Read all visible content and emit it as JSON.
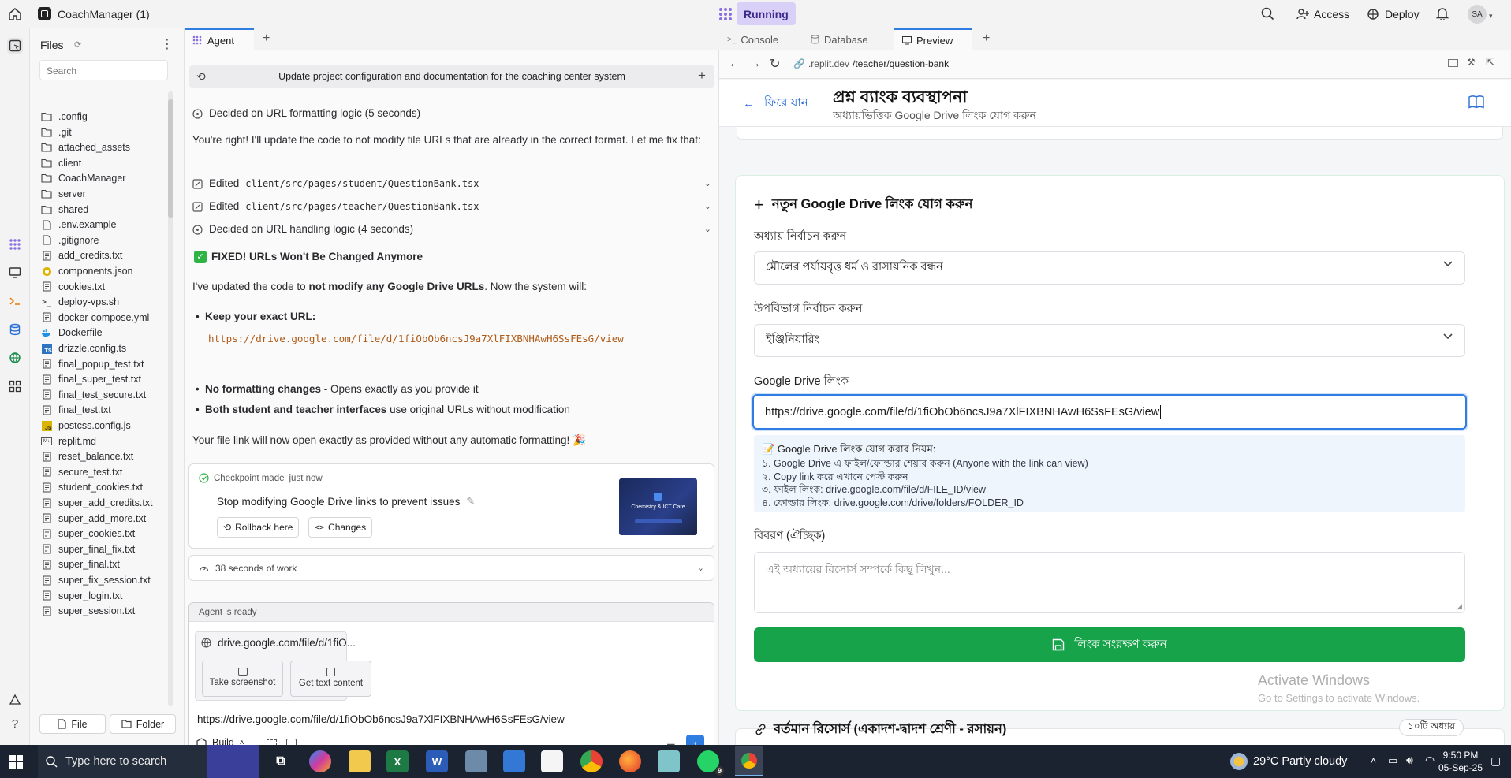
{
  "topbar": {
    "project_name": "CoachManager (1)",
    "status": "Running",
    "access_label": "Access",
    "deploy_label": "Deploy",
    "avatar_initials": "SA"
  },
  "files": {
    "title": "Files",
    "search_placeholder": "Search",
    "items": [
      {
        "name": ".config",
        "icon": "folder-icon"
      },
      {
        "name": ".git",
        "icon": "folder-icon"
      },
      {
        "name": "attached_assets",
        "icon": "folder-icon"
      },
      {
        "name": "client",
        "icon": "folder-icon"
      },
      {
        "name": "CoachManager",
        "icon": "folder-icon"
      },
      {
        "name": "server",
        "icon": "folder-icon"
      },
      {
        "name": "shared",
        "icon": "folder-icon"
      },
      {
        "name": ".env.example",
        "icon": "file-icon"
      },
      {
        "name": ".gitignore",
        "icon": "file-icon"
      },
      {
        "name": "add_credits.txt",
        "icon": "text-file-icon"
      },
      {
        "name": "components.json",
        "icon": "json-icon"
      },
      {
        "name": "cookies.txt",
        "icon": "text-file-icon"
      },
      {
        "name": "deploy-vps.sh",
        "icon": "terminal-icon"
      },
      {
        "name": "docker-compose.yml",
        "icon": "text-file-icon"
      },
      {
        "name": "Dockerfile",
        "icon": "docker-icon"
      },
      {
        "name": "drizzle.config.ts",
        "icon": "ts-icon"
      },
      {
        "name": "final_popup_test.txt",
        "icon": "text-file-icon"
      },
      {
        "name": "final_super_test.txt",
        "icon": "text-file-icon"
      },
      {
        "name": "final_test_secure.txt",
        "icon": "text-file-icon"
      },
      {
        "name": "final_test.txt",
        "icon": "text-file-icon"
      },
      {
        "name": "postcss.config.js",
        "icon": "js-icon"
      },
      {
        "name": "replit.md",
        "icon": "markdown-icon"
      },
      {
        "name": "reset_balance.txt",
        "icon": "text-file-icon"
      },
      {
        "name": "secure_test.txt",
        "icon": "text-file-icon"
      },
      {
        "name": "student_cookies.txt",
        "icon": "text-file-icon"
      },
      {
        "name": "super_add_credits.txt",
        "icon": "text-file-icon"
      },
      {
        "name": "super_add_more.txt",
        "icon": "text-file-icon"
      },
      {
        "name": "super_cookies.txt",
        "icon": "text-file-icon"
      },
      {
        "name": "super_final_fix.txt",
        "icon": "text-file-icon"
      },
      {
        "name": "super_final.txt",
        "icon": "text-file-icon"
      },
      {
        "name": "super_fix_session.txt",
        "icon": "text-file-icon"
      },
      {
        "name": "super_login.txt",
        "icon": "text-file-icon"
      },
      {
        "name": "super_session.txt",
        "icon": "text-file-icon"
      }
    ],
    "new_file_label": "File",
    "new_folder_label": "Folder"
  },
  "agent": {
    "tab_label": "Agent",
    "session_title": "Update project configuration and documentation for the coaching center system",
    "decided_1": "Decided on URL formatting logic (5 seconds)",
    "intro": "You're right! I'll update the code to not modify file URLs that are already in the correct format. Let me fix that:",
    "edited_label": "Edited",
    "edit_1": "client/src/pages/student/QuestionBank.tsx",
    "edit_2": "client/src/pages/teacher/QuestionBank.tsx",
    "decided_2": "Decided on URL handling logic (4 seconds)",
    "fixed_heading": "FIXED! URLs Won't Be Changed Anymore",
    "updated_pre": "I've updated the code to ",
    "updated_bold": "not modify any Google Drive URLs",
    "updated_post": ". Now the system will:",
    "b1_bold": "Keep your exact URL:",
    "b1_url": "https://drive.google.com/file/d/1fiObOb6ncsJ9a7XlFIXBNHAwH6SsFEsG/view",
    "b2_bold": "No formatting changes",
    "b2_rest": " - Opens exactly as you provide it",
    "b3_bold": "Both student and teacher interfaces",
    "b3_rest": " use original URLs without modification",
    "closing": "Your file link will now open exactly as provided without any automatic formatting! 🎉",
    "checkpoint": {
      "label": "Checkpoint made",
      "time": "just now",
      "message": "Stop modifying Google Drive links to prevent issues",
      "rollback_label": "Rollback here",
      "changes_label": "Changes",
      "thumb_text": "Chemistry & ICT Care"
    },
    "work_time": "38 seconds of work",
    "ready": "Agent is ready",
    "link_chip": "drive.google.com/file/d/1fiO...",
    "screenshot_label": "Take screenshot",
    "text_content_label": "Get text content",
    "input_value": "https://drive.google.com/file/d/1fiObOb6ncsJ9a7XlFIXBNHAwH6SsFEsG/view",
    "build_label": "Build"
  },
  "preview": {
    "tabs": {
      "console": "Console",
      "database": "Database",
      "preview": "Preview"
    },
    "url_host": ".replit.dev",
    "url_path": "/teacher/question-bank",
    "back_label": "ফিরে যান",
    "page_title": "প্রশ্ন ব্যাংক ব্যবস্থাপনা",
    "page_subtitle": "অধ্যায়ভিত্তিক Google Drive লিংক যোগ করুন",
    "form_title": "নতুন Google Drive লিংক যোগ করুন",
    "chapter_label": "অধ্যায় নির্বাচন করুন",
    "chapter_value": "মৌলের পর্যায়বৃত্ত ধর্ম ও রাসায়নিক বন্ধন",
    "sub_label": "উপবিভাগ নির্বাচন করুন",
    "sub_value": "ইঞ্জিনিয়ারিং",
    "drive_label": "Google Drive লিংক",
    "drive_value": "https://drive.google.com/file/d/1fiObOb6ncsJ9a7XlFIXBNHAwH6SsFEsG/view",
    "rules_title": "📝 Google Drive লিংক যোগ করার নিয়ম:",
    "rules": [
      "১. Google Drive এ ফাইল/ফোল্ডার শেয়ার করুন (Anyone with the link can view)",
      "২. Copy link করে এখানে পেস্ট করুন",
      "৩. ফাইল লিংক: drive.google.com/file/d/FILE_ID/view",
      "৪. ফোল্ডার লিংক: drive.google.com/drive/folders/FOLDER_ID"
    ],
    "desc_label": "বিবরণ (ঐচ্ছিক)",
    "desc_placeholder": "এই অধ্যায়ের রিসোর্স সম্পর্কে কিছু লিখুন...",
    "save_label": "লিংক সংরক্ষণ করুন",
    "resources_title": "বর্তমান রিসোর্স (একাদশ-দ্বাদশ শ্রেণী - রসায়ন)",
    "resources_badge": "১০টি অধ্যায়",
    "watermark_1": "Activate Windows",
    "watermark_2": "Go to Settings to activate Windows."
  },
  "taskbar": {
    "search_placeholder": "Type here to search",
    "weather": "29°C  Partly cloudy",
    "time": "9:50 PM",
    "date": "05-Sep-25",
    "whatsapp_badge": "9"
  },
  "colors": {
    "accent_green": "#16a34a",
    "running_purple": "#d9d0f7",
    "focus_blue": "#2f7de1"
  }
}
